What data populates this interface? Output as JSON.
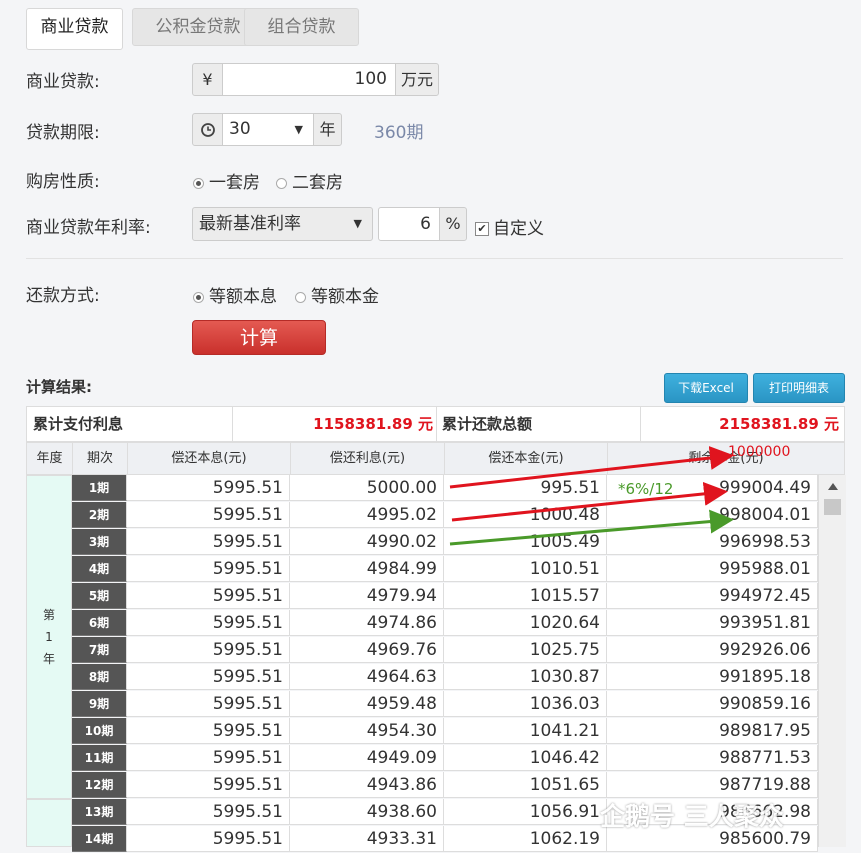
{
  "tabs": [
    "商业贷款",
    "公积金贷款",
    "组合贷款"
  ],
  "form": {
    "loan_label": "商业贷款:",
    "currency": "¥",
    "loan_amount": "100",
    "loan_unit": "万元",
    "term_label": "贷款期限:",
    "term_value": "30",
    "term_unit": "年",
    "periods": "360期",
    "nature_label": "购房性质:",
    "nature_opt1": "一套房",
    "nature_opt2": "二套房",
    "rate_label": "商业贷款年利率:",
    "rate_select": "最新基准利率",
    "rate_value": "6",
    "rate_unit": "%",
    "custom_label": "自定义",
    "method_label": "还款方式:",
    "method_opt1": "等额本息",
    "method_opt2": "等额本金",
    "calc_button": "计算"
  },
  "result": {
    "title": "计算结果:",
    "excel_button": "下载Excel",
    "print_button": "打印明细表",
    "interest_label": "累计支付利息",
    "interest_value": "1158381.89 元",
    "total_label": "累计还款总额",
    "total_value": "2158381.89 元"
  },
  "table": {
    "headers": [
      "年度",
      "期次",
      "偿还本息(元)",
      "偿还利息(元)",
      "偿还本金(元)",
      "剩余本金(元)"
    ],
    "year1": "第\n1\n年",
    "rows": [
      [
        "1期",
        "5995.51",
        "5000.00",
        "995.51",
        "999004.49"
      ],
      [
        "2期",
        "5995.51",
        "4995.02",
        "1000.48",
        "998004.01"
      ],
      [
        "3期",
        "5995.51",
        "4990.02",
        "1005.49",
        "996998.53"
      ],
      [
        "4期",
        "5995.51",
        "4984.99",
        "1010.51",
        "995988.01"
      ],
      [
        "5期",
        "5995.51",
        "4979.94",
        "1015.57",
        "994972.45"
      ],
      [
        "6期",
        "5995.51",
        "4974.86",
        "1020.64",
        "993951.81"
      ],
      [
        "7期",
        "5995.51",
        "4969.76",
        "1025.75",
        "992926.06"
      ],
      [
        "8期",
        "5995.51",
        "4964.63",
        "1030.87",
        "991895.18"
      ],
      [
        "9期",
        "5995.51",
        "4959.48",
        "1036.03",
        "990859.16"
      ],
      [
        "10期",
        "5995.51",
        "4954.30",
        "1041.21",
        "989817.95"
      ],
      [
        "11期",
        "5995.51",
        "4949.09",
        "1046.42",
        "988771.53"
      ],
      [
        "12期",
        "5995.51",
        "4943.86",
        "1051.65",
        "987719.88"
      ],
      [
        "13期",
        "5995.51",
        "4938.60",
        "1056.91",
        "986662.98"
      ],
      [
        "14期",
        "5995.51",
        "4933.31",
        "1062.19",
        "985600.79"
      ]
    ]
  },
  "annotations": {
    "principal": "1000000",
    "rate_note": "*6%/12",
    "red": "#e0141e",
    "green": "#4a9a2a"
  },
  "watermark": "企鹅号 三人聚众"
}
